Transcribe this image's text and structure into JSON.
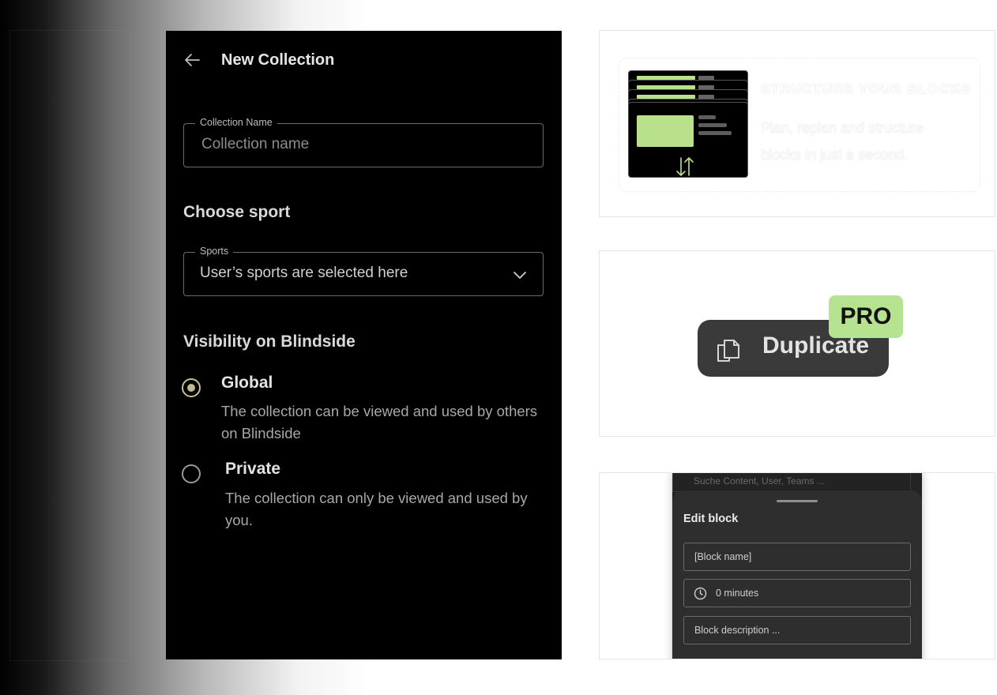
{
  "collection_form": {
    "header": {
      "title": "New Collection"
    },
    "name_field": {
      "label": "Collection Name",
      "placeholder": "Collection name"
    },
    "sport_section": {
      "title": "Choose sport"
    },
    "sport_field": {
      "label": "Sports",
      "value": "User’s sports are selected here"
    },
    "visibility": {
      "title": "Visibility on Blindside",
      "options": [
        {
          "title": "Global",
          "description": "The collection can be viewed and used by others on Blindside",
          "selected": true
        },
        {
          "title": "Private",
          "description": "The collection can only be viewed and used by you.",
          "selected": false
        }
      ]
    }
  },
  "feature_cards": {
    "structure": {
      "title": "STRUCTURE YOUR BLOCKS",
      "description": "Plan, replan and structure blocks in just a second."
    },
    "duplicate": {
      "button_label": "Duplicate",
      "badge": "PRO"
    },
    "edit_block": {
      "search_placeholder": "Suche Content, User, Teams ...",
      "title": "Edit block",
      "name_placeholder": "[Block name]",
      "duration_value": "0 minutes",
      "description_placeholder": "Block description ..."
    }
  },
  "colors": {
    "accent_green": "#b9e08b",
    "radio_selected": "#bfb98b",
    "panel_bg": "#000000",
    "button_bg": "#3a3a3a"
  },
  "icons": [
    "back-arrow-icon",
    "chevron-down-icon",
    "swap-arrows-icon",
    "copy-icon",
    "clock-icon"
  ]
}
